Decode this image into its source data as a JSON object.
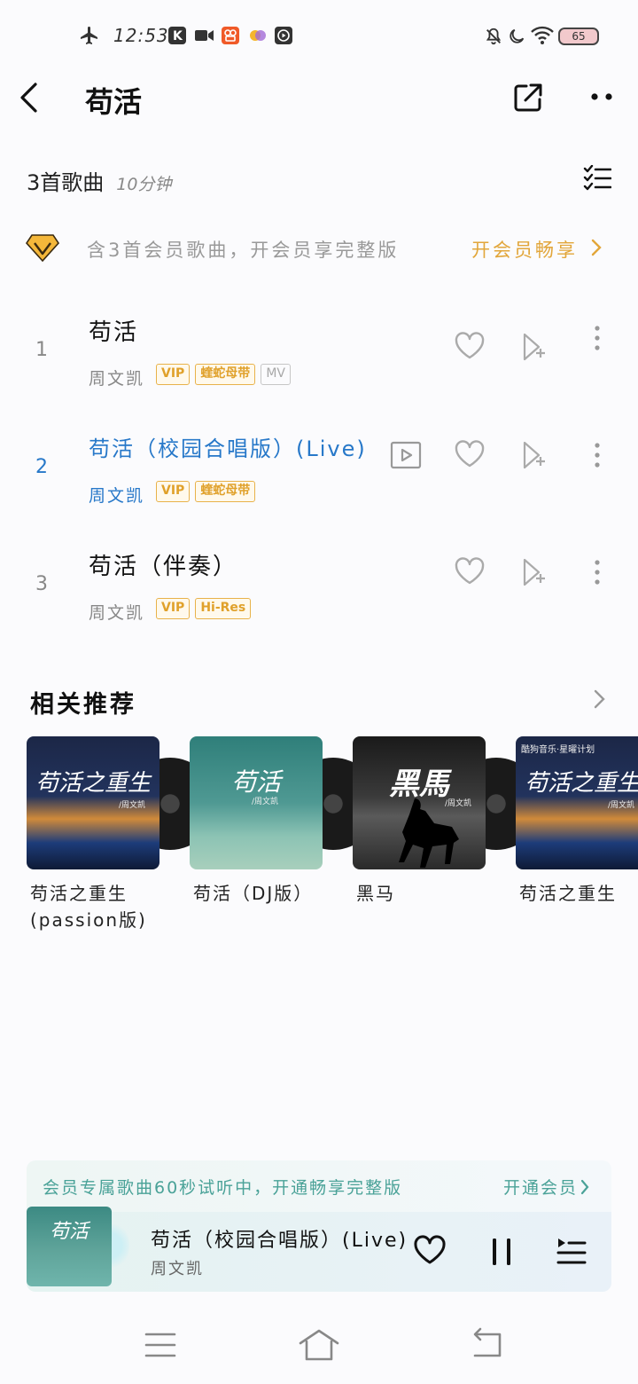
{
  "status_bar": {
    "time": "12:53",
    "battery": "65"
  },
  "header": {
    "title": "苟活",
    "icons": [
      "back-icon",
      "share-icon",
      "more-icon"
    ]
  },
  "list_header": {
    "count_label": "3首歌曲",
    "duration_label": "10分钟"
  },
  "vip_banner": {
    "text": "含3首会员歌曲，开会员享完整版",
    "cta": "开会员畅享"
  },
  "songs": [
    {
      "index": "1",
      "title": "苟活",
      "artist": "周文凯",
      "tags": [
        "VIP",
        "蝰蛇母带",
        "MV"
      ]
    },
    {
      "index": "2",
      "title": "苟活（校园合唱版）(Live)",
      "artist": "周文凯",
      "tags": [
        "VIP",
        "蝰蛇母带"
      ]
    },
    {
      "index": "3",
      "title": "苟活（伴奏）",
      "artist": "周文凯",
      "tags": [
        "VIP",
        "Hi-Res"
      ]
    }
  ],
  "related": {
    "title": "相关推荐",
    "items": [
      {
        "title": "苟活之重生(passion版)",
        "cover_text": "苟活之重生",
        "cover_sub": "/周文凯"
      },
      {
        "title": "苟活（DJ版）",
        "cover_text": "苟活",
        "cover_sub": "/周文凯"
      },
      {
        "title": "黑马",
        "cover_text": "黑馬",
        "cover_sub": "/周文凯"
      },
      {
        "title": "苟活之重生",
        "cover_text": "苟活之重生",
        "cover_sub": "/周文凯",
        "cover_top": "酷狗音乐·星曜计划"
      }
    ]
  },
  "trial_banner": {
    "text": "会员专属歌曲60秒试听中，开通畅享完整版",
    "cta": "开通会员"
  },
  "player": {
    "title": "苟活（校园合唱版）(Live)",
    "artist": "周文凯",
    "cover_text": "苟活"
  },
  "colors": {
    "accent_blue": "#2778c9",
    "vip_gold": "#e2a63a",
    "trial_green": "#4aa298"
  }
}
